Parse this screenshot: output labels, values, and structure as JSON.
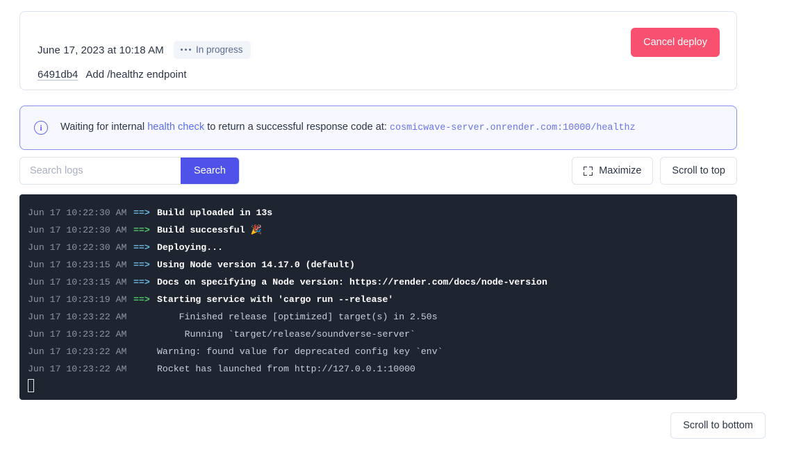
{
  "deploy": {
    "date": "June 17, 2023 at 10:18 AM",
    "status_label": "In progress",
    "commit_hash": "6491db4",
    "commit_message": "Add /healthz endpoint",
    "cancel_label": "Cancel deploy"
  },
  "banner": {
    "icon": "info-icon",
    "text_before_link": "Waiting for internal ",
    "link_text": "health check",
    "text_after_link": " to return a successful response code at: ",
    "url": "cosmicwave-server.onrender.com:10000/healthz"
  },
  "search": {
    "placeholder": "Search logs",
    "value": "",
    "submit_label": "Search",
    "maximize_label": "Maximize",
    "scroll_top_label": "Scroll to top"
  },
  "footer": {
    "scroll_bottom_label": "Scroll to bottom"
  },
  "logs": [
    {
      "ts": "Jun 17 10:22:30 AM",
      "arrow": "==>",
      "arrow_color": "cyan",
      "msg": "Build uploaded in 13s",
      "bold": true
    },
    {
      "ts": "Jun 17 10:22:30 AM",
      "arrow": "==>",
      "arrow_color": "green",
      "msg": "Build successful 🎉",
      "bold": true
    },
    {
      "ts": "Jun 17 10:22:30 AM",
      "arrow": "==>",
      "arrow_color": "cyan",
      "msg": "Deploying...",
      "bold": true
    },
    {
      "ts": "Jun 17 10:23:15 AM",
      "arrow": "==>",
      "arrow_color": "cyan",
      "msg": "Using Node version 14.17.0 (default)",
      "bold": true
    },
    {
      "ts": "Jun 17 10:23:15 AM",
      "arrow": "==>",
      "arrow_color": "cyan",
      "msg": "Docs on specifying a Node version: https://render.com/docs/node-version",
      "bold": true
    },
    {
      "ts": "Jun 17 10:23:19 AM",
      "arrow": "==>",
      "arrow_color": "green",
      "msg": "Starting service with 'cargo run --release'",
      "bold": true
    },
    {
      "ts": "Jun 17 10:23:22 AM",
      "arrow": "",
      "arrow_color": "blank",
      "msg": "    Finished release [optimized] target(s) in 2.50s",
      "bold": false
    },
    {
      "ts": "Jun 17 10:23:22 AM",
      "arrow": "",
      "arrow_color": "blank",
      "msg": "     Running `target/release/soundverse-server`",
      "bold": false
    },
    {
      "ts": "Jun 17 10:23:22 AM",
      "arrow": "",
      "arrow_color": "blank",
      "msg": "Warning: found value for deprecated config key `env`",
      "bold": false
    },
    {
      "ts": "Jun 17 10:23:22 AM",
      "arrow": "",
      "arrow_color": "blank",
      "msg": "Rocket has launched from http://127.0.0.1:10000",
      "bold": false
    }
  ],
  "colors": {
    "accent": "#4f52e8",
    "danger": "#f8516f",
    "terminal_bg": "#1e2430",
    "banner_border": "#8b8ff0"
  }
}
